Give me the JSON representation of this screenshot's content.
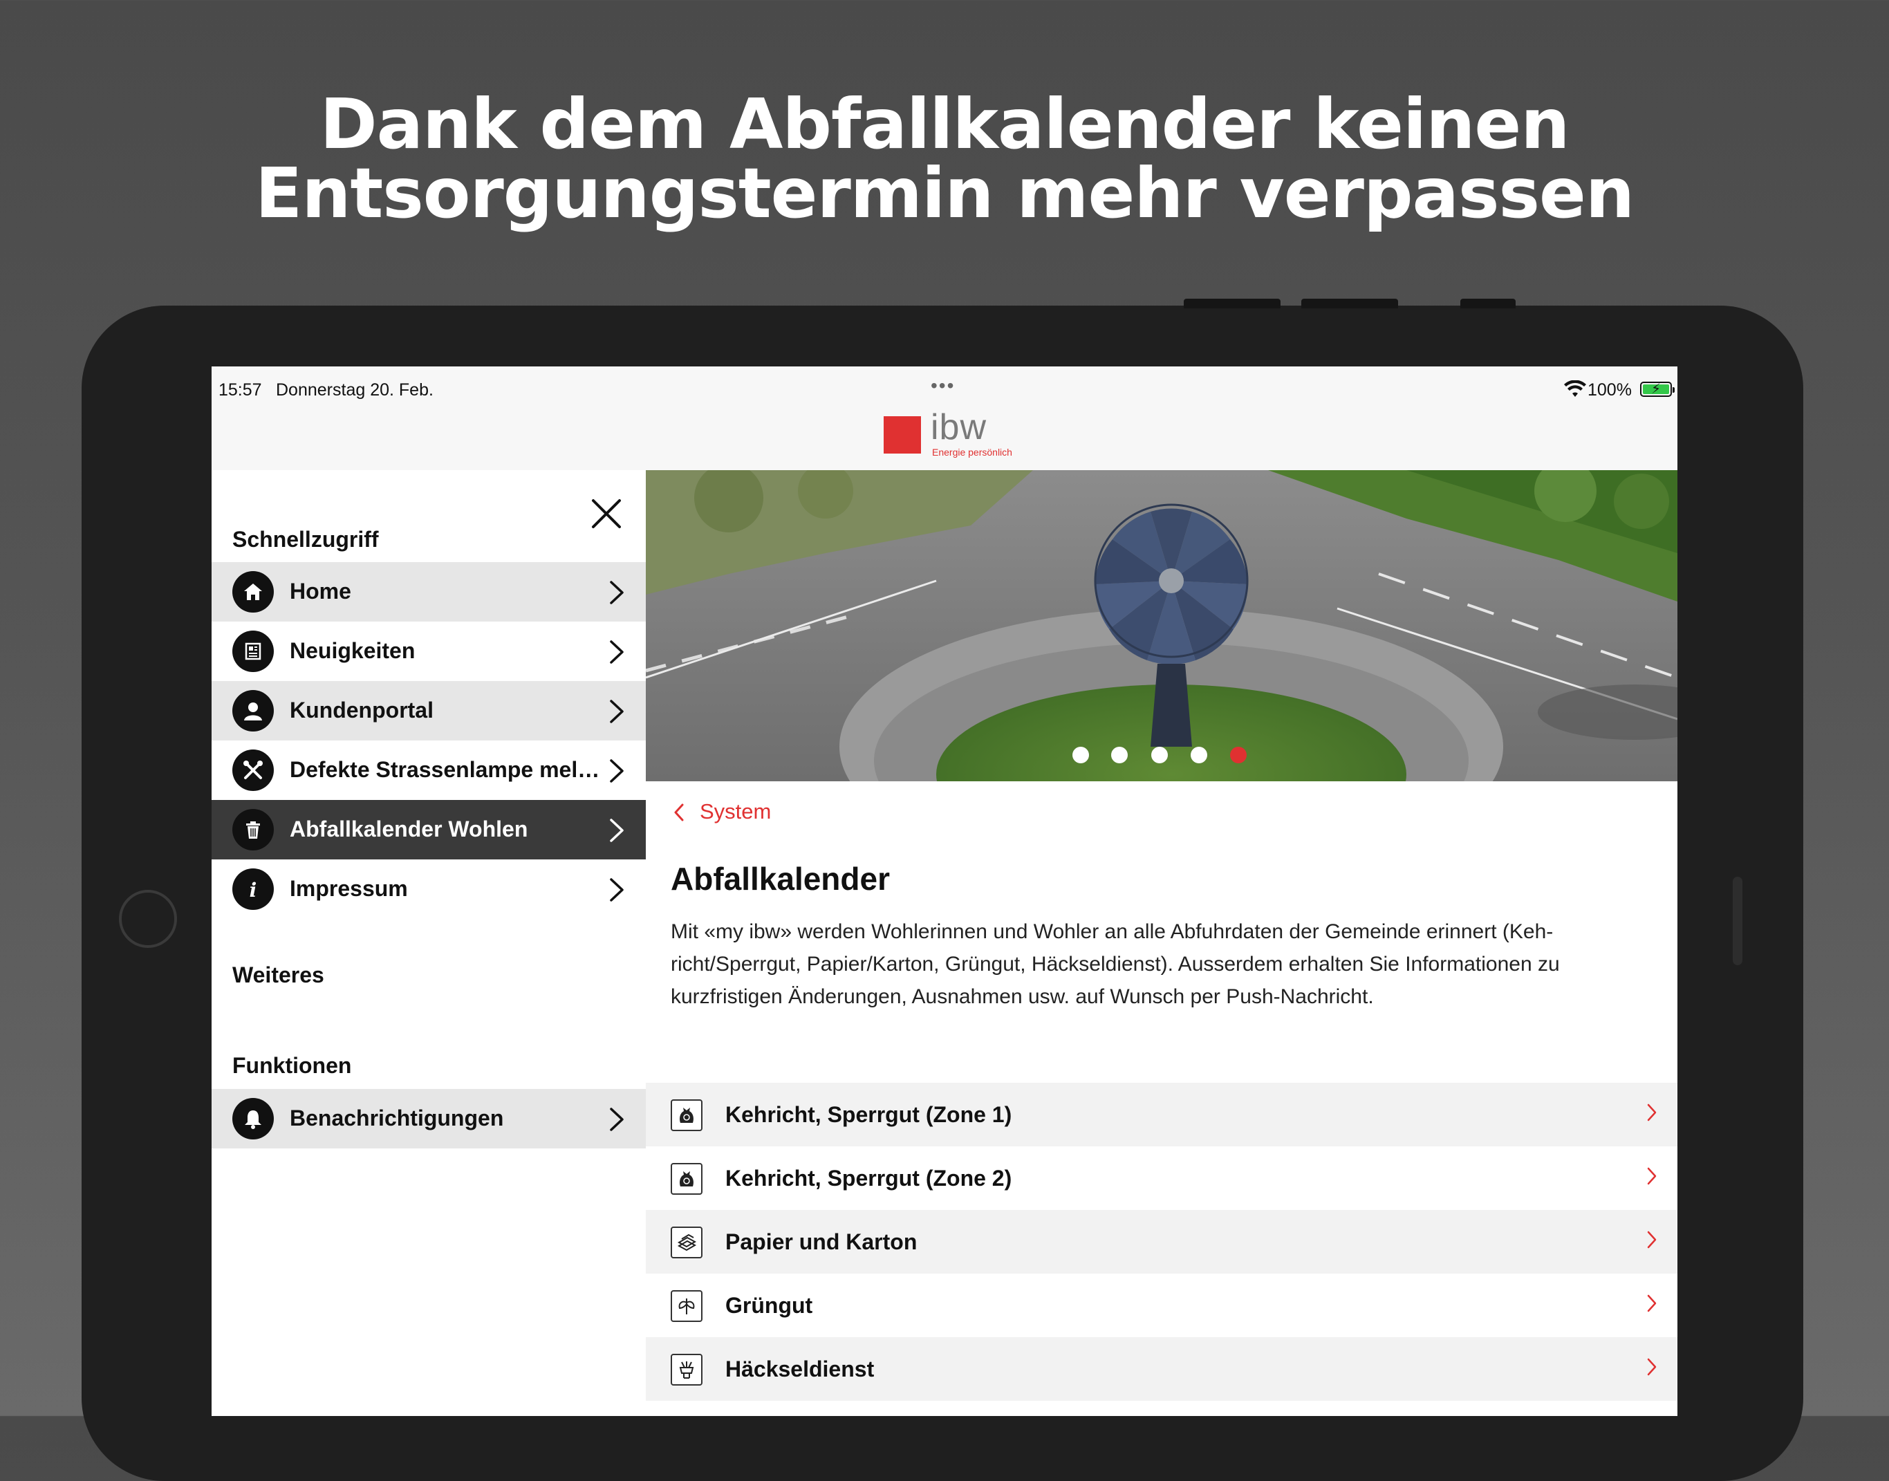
{
  "promo": {
    "headline_line1": "Dank dem Abfallkalender keinen",
    "headline_line2": "Entsorgungstermin mehr verpassen"
  },
  "status_bar": {
    "time": "15:57",
    "date": "Donnerstag 20. Feb.",
    "battery_percent": "100%",
    "battery_level": 1.0
  },
  "app": {
    "logo_text": "ibw",
    "logo_tagline": "Energie persönlich",
    "brand_color": "#e03131"
  },
  "sidebar": {
    "section_quick": "Schnellzugriff",
    "section_more": "Weiteres",
    "section_functions": "Funktionen",
    "quick_items": [
      {
        "label": "Home",
        "icon": "home-icon"
      },
      {
        "label": "Neuigkeiten",
        "icon": "newspaper-icon"
      },
      {
        "label": "Kundenportal",
        "icon": "user-icon"
      },
      {
        "label": "Defekte Strassenlampe mel…",
        "icon": "tools-icon"
      },
      {
        "label": "Abfallkalender Wohlen",
        "icon": "trash-icon",
        "selected": true
      },
      {
        "label": "Impressum",
        "icon": "info-icon"
      }
    ],
    "function_items": [
      {
        "label": "Benachrichtigungen",
        "icon": "bell-icon"
      }
    ]
  },
  "main": {
    "carousel": {
      "page_count": 5,
      "active_index": 4
    },
    "back_label": "System",
    "title": "Abfallkalender",
    "description_lines": [
      "Mit «my ibw» werden Wohlerinnen und Wohler an alle Abfuhrdaten der Gemeinde erinnert (Keh-",
      "richt/Sperrgut, Papier/Karton, Grüngut, Häckseldienst). Ausserdem erhalten Sie Informationen zu",
      "kurzfristigen Änderungen, Ausnahmen usw. auf Wunsch per Push-Nachricht."
    ],
    "categories": [
      {
        "label": "Kehricht, Sperrgut (Zone 1)",
        "icon": "garbage-bag-icon"
      },
      {
        "label": "Kehricht, Sperrgut (Zone 2)",
        "icon": "garbage-bag-icon"
      },
      {
        "label": "Papier und Karton",
        "icon": "paper-stack-icon"
      },
      {
        "label": "Grüngut",
        "icon": "leaf-icon"
      },
      {
        "label": "Häckseldienst",
        "icon": "shredder-icon"
      }
    ]
  }
}
